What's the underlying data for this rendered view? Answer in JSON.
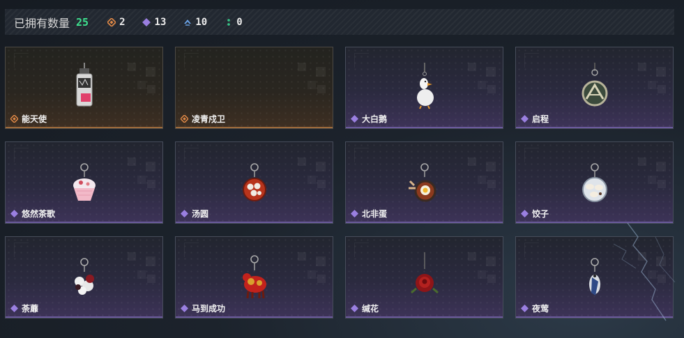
{
  "header": {
    "owned_label": "已拥有数量",
    "owned_count": "25",
    "stats": [
      {
        "icon": "orange-diamond-icon",
        "color": "#e38a47",
        "value": "2"
      },
      {
        "icon": "purple-diamond-icon",
        "color": "#9a7fe0",
        "value": "13"
      },
      {
        "icon": "blue-chevron-icon",
        "color": "#6aa3e8",
        "value": "10"
      },
      {
        "icon": "green-dots-icon",
        "color": "#38c98a",
        "value": "0"
      }
    ]
  },
  "items": [
    {
      "name": "能天使",
      "rarity": "orange",
      "art": "bottle"
    },
    {
      "name": "凌青戍卫",
      "rarity": "orange",
      "art": "none"
    },
    {
      "name": "大白鹅",
      "rarity": "purple",
      "art": "goose"
    },
    {
      "name": "启程",
      "rarity": "purple",
      "art": "medal"
    },
    {
      "name": "悠然茶歌",
      "rarity": "purple",
      "art": "cupcake"
    },
    {
      "name": "汤圆",
      "rarity": "purple",
      "art": "bowl"
    },
    {
      "name": "北非蛋",
      "rarity": "purple",
      "art": "egg"
    },
    {
      "name": "饺子",
      "rarity": "purple",
      "art": "dumpling"
    },
    {
      "name": "荼蘼",
      "rarity": "purple",
      "art": "flower-cluster"
    },
    {
      "name": "马到成功",
      "rarity": "purple",
      "art": "horse"
    },
    {
      "name": "缄花",
      "rarity": "purple",
      "art": "rose"
    },
    {
      "name": "夜莺",
      "rarity": "purple",
      "art": "bird"
    }
  ]
}
